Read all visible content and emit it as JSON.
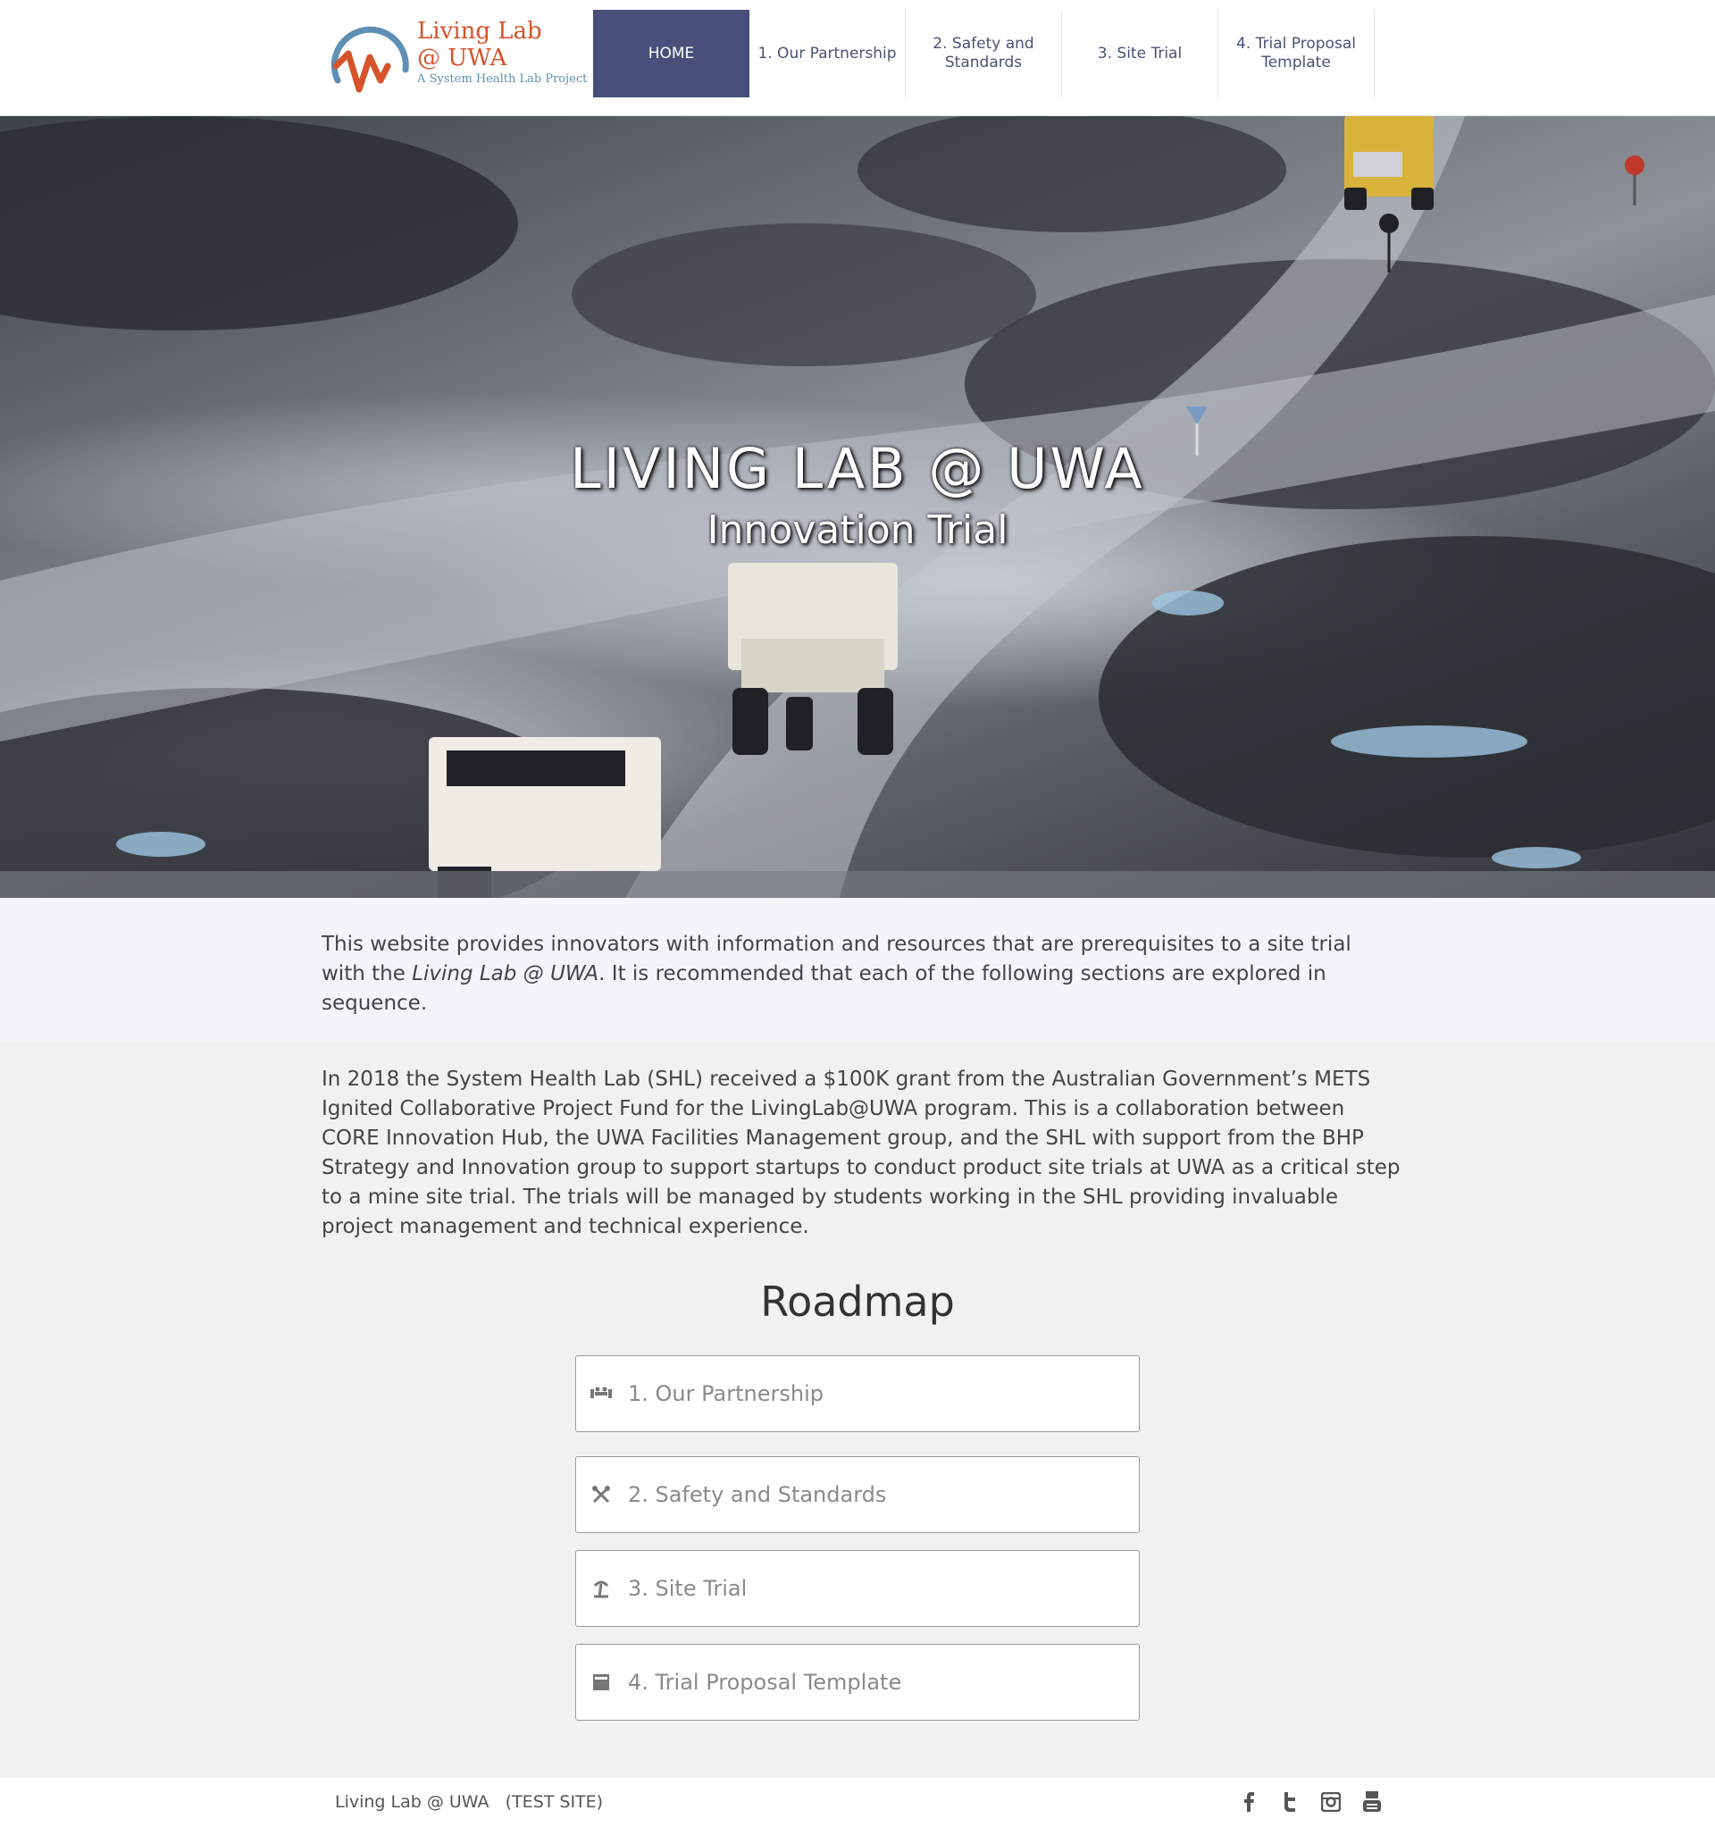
{
  "header": {
    "logo": {
      "line1": "Living Lab",
      "line2": "@ UWA",
      "tagline": "A System Health Lab Project"
    },
    "nav": [
      {
        "label": "HOME",
        "active": true
      },
      {
        "label": "1. Our Partnership",
        "active": false
      },
      {
        "label": "2. Safety and Standards",
        "active": false
      },
      {
        "label": "3. Site Trial",
        "active": false
      },
      {
        "label": "4. Trial Proposal Template",
        "active": false
      }
    ]
  },
  "hero": {
    "title": "LIVING LAB @ UWA",
    "subtitle": "Innovation Trial"
  },
  "intro": {
    "text_before": "This website provides innovators with information and resources that are prerequisites to a site trial with the ",
    "emphasis": "Living Lab @ UWA",
    "text_after": ". It is recommended that each of the following sections are explored in sequence."
  },
  "body": {
    "paragraph": "In 2018 the System Health Lab (SHL) received a $100K grant from the Australian Government’s METS Ignited Collaborative Project Fund for the LivingLab@UWA program. This is a collaboration between CORE Innovation Hub, the UWA Facilities Management group, and the SHL with support from the BHP Strategy and Innovation group to support startups to conduct product site trials at UWA as a critical step to a mine site trial. The trials will be managed by students working in the SHL providing invaluable project management and technical experience."
  },
  "roadmap": {
    "title": "Roadmap",
    "items": [
      {
        "label": "1. Our Partnership",
        "icon": "partnership-icon"
      },
      {
        "label": "2. Safety and Standards",
        "icon": "tools-icon"
      },
      {
        "label": "3. Site Trial",
        "icon": "site-icon"
      },
      {
        "label": "4. Trial Proposal Template",
        "icon": "document-icon"
      }
    ]
  },
  "footer": {
    "text": "Living Lab @ UWA   (TEST SITE)",
    "social": [
      "facebook-icon",
      "twitter-icon",
      "instagram-icon",
      "youtube-icon"
    ]
  },
  "colors": {
    "nav_active": "#474f7a",
    "nav_text": "#4a5277",
    "logo_orange": "#d6532b",
    "logo_blue": "#5f8fb4"
  }
}
